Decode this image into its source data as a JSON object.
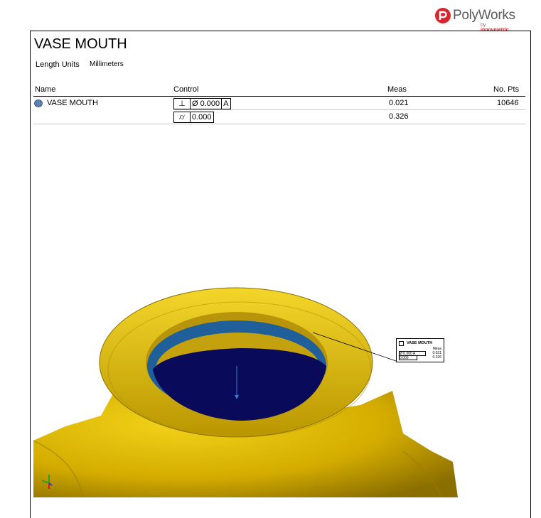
{
  "brand": {
    "name": "PolyWorks",
    "by_prefix": "by",
    "by_company": "innovmetric"
  },
  "report": {
    "title": "VASE MOUTH",
    "units_label": "Length Units",
    "units_value": "Millimeters"
  },
  "table": {
    "headers": {
      "name": "Name",
      "control": "Control",
      "meas": "Meas",
      "pts": "No. Pts"
    },
    "rows": [
      {
        "name": "VASE MOUTH",
        "symbol": "⊥",
        "dia": "Ø",
        "tol": "0.000",
        "datum": "A",
        "meas": "0.021",
        "pts": "10646"
      },
      {
        "symbol": "⌭",
        "tol": "0.000",
        "meas": "0.326"
      }
    ]
  },
  "callout": {
    "title": "VASE MOUTH",
    "meas_header": "Meas",
    "row1": "Ø 0.000 A",
    "meas1": "0.021",
    "row2": "0.000",
    "meas2": "0.326"
  },
  "colors": {
    "body": "#e6c100",
    "interior": "#0a0a5a",
    "ring": "#1f5f9a",
    "accent": "#d9262c"
  }
}
